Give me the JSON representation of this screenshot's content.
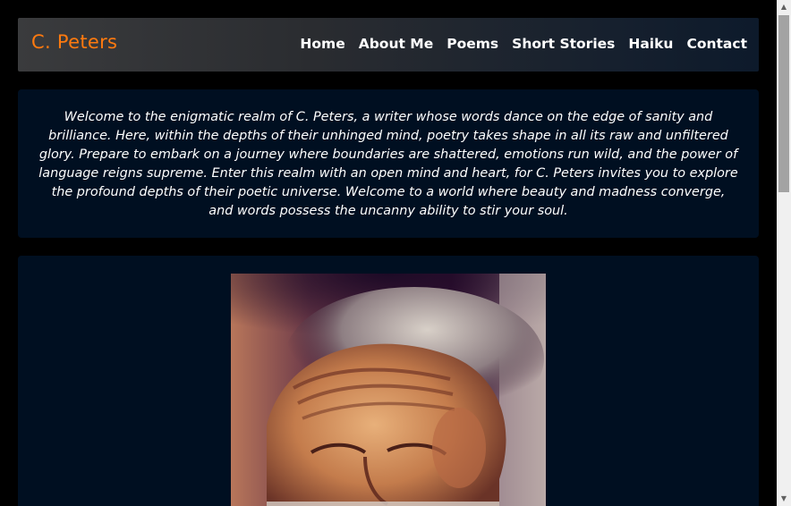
{
  "brand": {
    "name": "C. Peters",
    "color": "#ff7a0f"
  },
  "nav": {
    "items": [
      {
        "label": "Home"
      },
      {
        "label": "About Me"
      },
      {
        "label": "Poems"
      },
      {
        "label": "Short Stories"
      },
      {
        "label": "Haiku"
      },
      {
        "label": "Contact"
      }
    ]
  },
  "intro": {
    "text": "Welcome to the enigmatic realm of C. Peters, a writer whose words dance on the edge of sanity and brilliance. Here, within the depths of their unhinged mind, poetry takes shape in all its raw and unfiltered glory. Prepare to embark on a journey where boundaries are shattered, emotions run wild, and the power of language reigns supreme. Enter this realm with an open mind and heart, for C. Peters invites you to explore the profound depths of their poetic universe. Welcome to a world where beauty and madness converge, and words possess the uncanny ability to stir your soul."
  },
  "colors": {
    "background": "#000000",
    "card": "#000f21",
    "accent": "#ff7a0f",
    "text": "#ffffff"
  },
  "icons": {
    "scroll_up": "scroll-up-arrow-icon",
    "scroll_down": "scroll-down-arrow-icon"
  }
}
